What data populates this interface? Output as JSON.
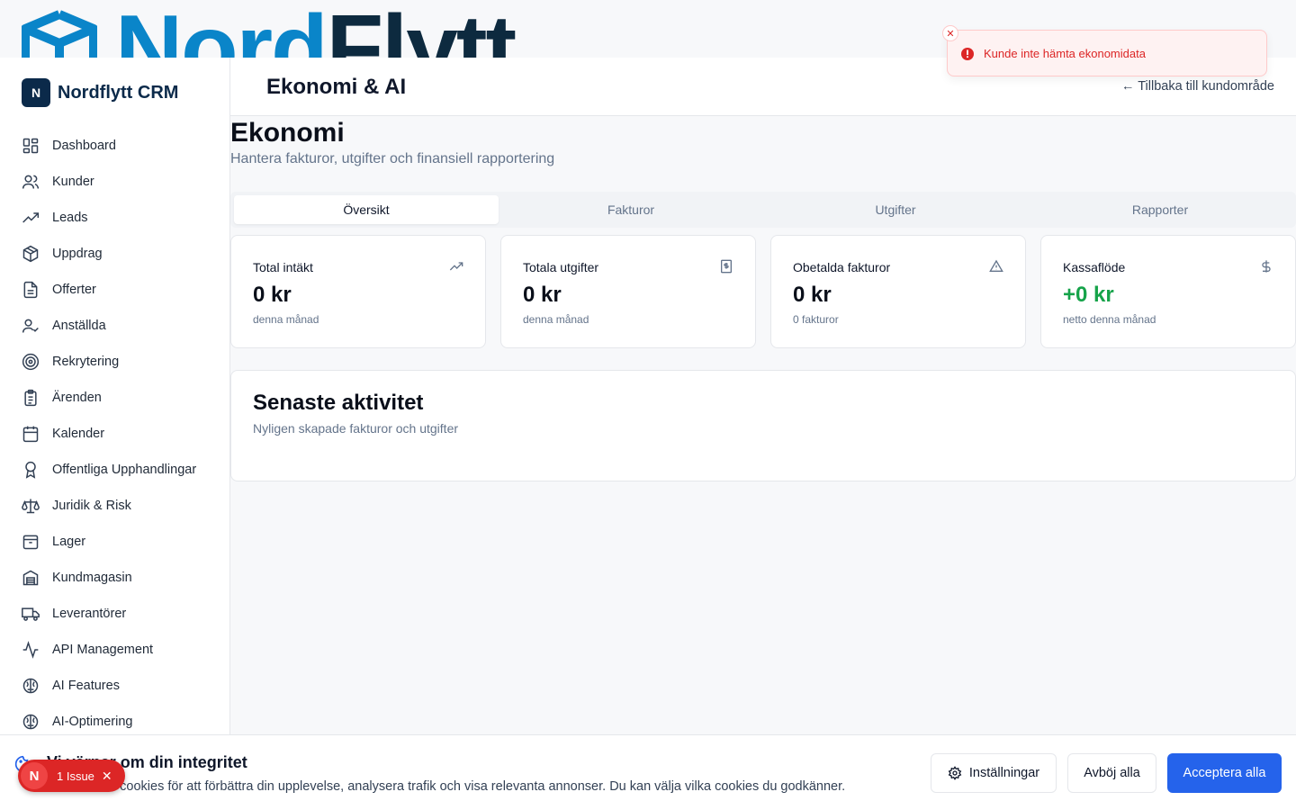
{
  "top_logo": {
    "text_part1": "Nord",
    "text_part2": "Flytt"
  },
  "sidebar": {
    "brand_initial": "N",
    "brand_name": "Nordflytt CRM",
    "items": [
      {
        "label": "Dashboard",
        "icon": "dashboard-icon"
      },
      {
        "label": "Kunder",
        "icon": "users-icon"
      },
      {
        "label": "Leads",
        "icon": "trending-up-icon"
      },
      {
        "label": "Uppdrag",
        "icon": "package-icon"
      },
      {
        "label": "Offerter",
        "icon": "file-text-icon"
      },
      {
        "label": "Anställda",
        "icon": "user-check-icon"
      },
      {
        "label": "Rekrytering",
        "icon": "target-icon"
      },
      {
        "label": "Ärenden",
        "icon": "clipboard-icon"
      },
      {
        "label": "Kalender",
        "icon": "calendar-icon"
      },
      {
        "label": "Offentliga Upphandlingar",
        "icon": "award-icon"
      },
      {
        "label": "Juridik & Risk",
        "icon": "scale-icon"
      },
      {
        "label": "Lager",
        "icon": "archive-icon"
      },
      {
        "label": "Kundmagasin",
        "icon": "warehouse-icon"
      },
      {
        "label": "Leverantörer",
        "icon": "truck-icon"
      },
      {
        "label": "API Management",
        "icon": "activity-icon"
      },
      {
        "label": "AI Features",
        "icon": "brain-icon"
      },
      {
        "label": "AI-Optimering",
        "icon": "brain-icon"
      }
    ]
  },
  "header": {
    "title": "Ekonomi & AI",
    "back_link": "← Tillbaka till kundområde"
  },
  "main": {
    "title": "Ekonomi",
    "subtitle": "Hantera fakturor, utgifter och finansiell rapportering",
    "tabs": [
      {
        "label": "Översikt",
        "active": true
      },
      {
        "label": "Fakturor",
        "active": false
      },
      {
        "label": "Utgifter",
        "active": false
      },
      {
        "label": "Rapporter",
        "active": false
      }
    ],
    "cards": [
      {
        "title": "Total intäkt",
        "value": "0 kr",
        "note": "denna månad",
        "icon": "trending-up-icon"
      },
      {
        "title": "Totala utgifter",
        "value": "0 kr",
        "note": "denna månad",
        "icon": "receipt-icon"
      },
      {
        "title": "Obetalda fakturor",
        "value": "0 kr",
        "note": "0 fakturor",
        "icon": "alert-triangle-icon"
      },
      {
        "title": "Kassaflöde",
        "value": "+0 kr",
        "note": "netto denna månad",
        "icon": "dollar-icon"
      }
    ],
    "activity": {
      "title": "Senaste aktivitet",
      "subtitle": "Nyligen skapade fakturor och utgifter"
    }
  },
  "toast": {
    "message": "Kunde inte hämta ekonomidata",
    "close": "✕"
  },
  "cookie_banner": {
    "title": "Vi värnar om din integritet",
    "text": "Vi använder cookies för att förbättra din upplevelse, analysera trafik och visa relevanta annonser. Du kan välja vilka cookies du godkänner.",
    "settings_label": "Inställningar",
    "reject_label": "Avböj alla",
    "accept_label": "Acceptera alla"
  },
  "issue_badge": {
    "initial": "N",
    "label": "1 Issue",
    "close": "✕"
  },
  "colors": {
    "brand_navy": "#0b2a4a",
    "accent_blue": "#2563eb",
    "error_red": "#dc2626",
    "positive_green": "#16a34a"
  }
}
